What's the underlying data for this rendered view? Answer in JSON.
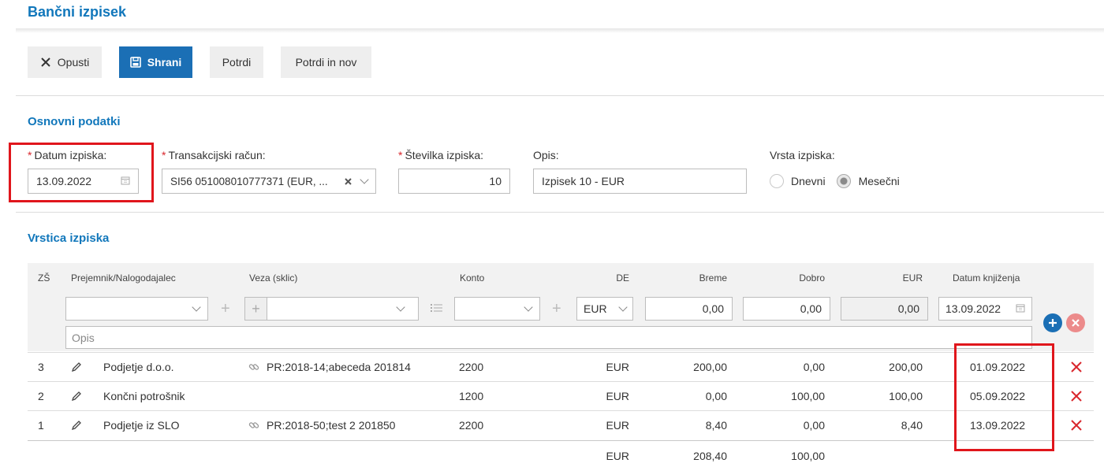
{
  "page": {
    "title": "Bančni izpisek"
  },
  "toolbar": {
    "cancel_label": "Opusti",
    "save_label": "Shrani",
    "confirm_label": "Potrdi",
    "confirm_new_label": "Potrdi in nov"
  },
  "basic": {
    "section_title": "Osnovni podatki",
    "date_label": "Datum izpiska:",
    "date_value": "13.09.2022",
    "account_label": "Transakcijski račun:",
    "account_value": "SI56 051008010777371 (EUR, ...",
    "number_label": "Številka izpiska:",
    "number_value": "10",
    "desc_label": "Opis:",
    "desc_value": "Izpisek 10 - EUR",
    "type_label": "Vrsta izpiska:",
    "type_daily": "Dnevni",
    "type_monthly": "Mesečni",
    "type_selected": "Mesečni",
    "required_mark": "*"
  },
  "lines": {
    "section_title": "Vrstica izpiska",
    "columns": {
      "zs": "ZŠ",
      "recipient": "Prejemnik/Nalogodajalec",
      "ref": "Veza (sklic)",
      "konto": "Konto",
      "de": "DE",
      "breme": "Breme",
      "dobro": "Dobro",
      "eur": "EUR",
      "date": "Datum knjiženja"
    },
    "entry": {
      "currency": "EUR",
      "breme": "0,00",
      "dobro": "0,00",
      "eur": "0,00",
      "date": "13.09.2022",
      "desc_placeholder": "Opis"
    },
    "rows": [
      {
        "zs": "3",
        "recipient": "Podjetje d.o.o.",
        "ref": "PR:2018-14;abeceda 201814",
        "konto": "2200",
        "de": "EUR",
        "breme": "200,00",
        "dobro": "0,00",
        "eur": "200,00",
        "date": "01.09.2022"
      },
      {
        "zs": "2",
        "recipient": "Končni potrošnik",
        "ref": "",
        "konto": "1200",
        "de": "EUR",
        "breme": "0,00",
        "dobro": "100,00",
        "eur": "100,00",
        "date": "05.09.2022"
      },
      {
        "zs": "1",
        "recipient": "Podjetje iz SLO",
        "ref": "PR:2018-50;test 2 201850",
        "konto": "2200",
        "de": "EUR",
        "breme": "8,40",
        "dobro": "0,00",
        "eur": "8,40",
        "date": "13.09.2022"
      }
    ],
    "totals": {
      "de": "EUR",
      "breme": "208,40",
      "dobro": "100,00"
    }
  },
  "colors": {
    "accent": "#1177bb",
    "primary_button": "#1b6fb5",
    "highlight_red": "#e0161c",
    "delete_red": "#d9262c"
  }
}
